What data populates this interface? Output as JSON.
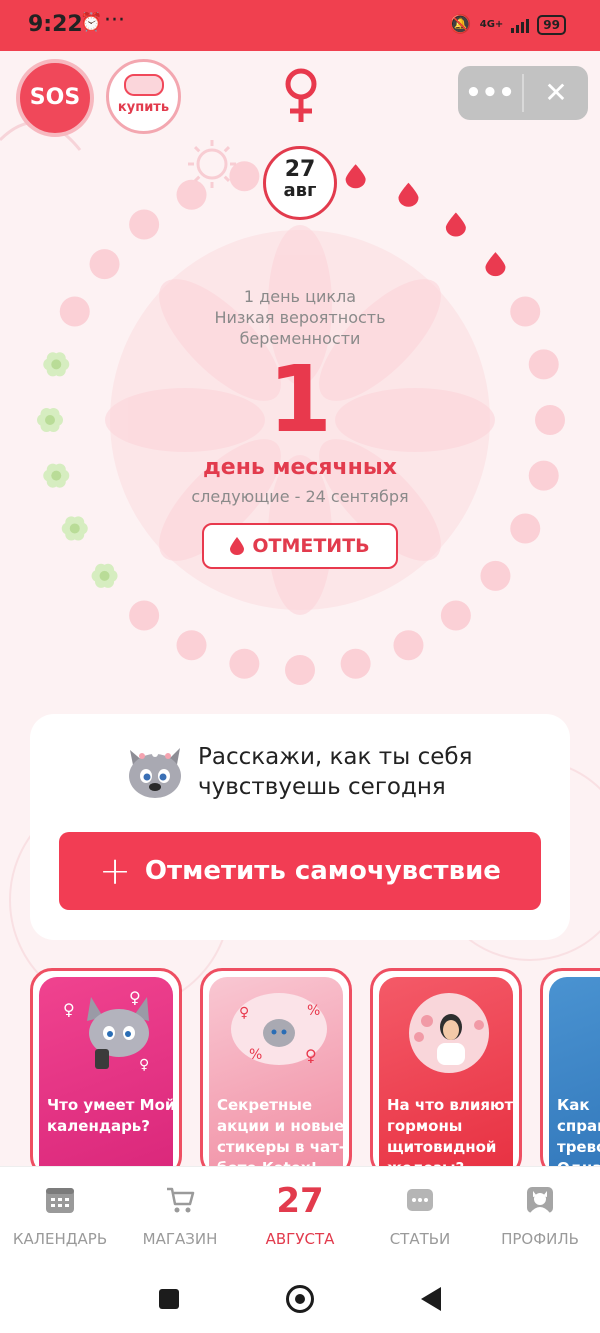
{
  "status_bar": {
    "time": "9:22",
    "dots": "···",
    "network": "4G+",
    "battery": "99"
  },
  "header": {
    "sos_label": "SOS",
    "buy_label": "купить",
    "more_label": "•••",
    "close_label": "✕"
  },
  "cycle": {
    "date_day": "27",
    "date_month": "авг",
    "cycle_day_line1": "1 день цикла",
    "cycle_day_line2": "Низкая вероятность",
    "cycle_day_line3": "беременности",
    "big_number": "1",
    "period_title": "день месячных",
    "next_period": "следующие - 24 сентября",
    "mark_button": "ОТМЕТИТЬ"
  },
  "mood": {
    "prompt_line1": "Расскажи, как ты себя",
    "prompt_line2": "чувствуешь сегодня",
    "button_plus": "+",
    "button_label": "Отметить самочувствие"
  },
  "articles": [
    {
      "title": "Что умеет Мой календарь?",
      "color": "#e8358a"
    },
    {
      "title": "Секретные акции и новые стикеры в чат-боте Kotex!",
      "color": "#f6a8b8"
    },
    {
      "title": "На что влияют гормоны щитовидной железы?",
      "color": "#ef3d4f"
    },
    {
      "title": "Как справиться с тревогой? Одна",
      "color": "#3f88c9"
    }
  ],
  "bottom_nav": {
    "calendar": "КАЛЕНДАРЬ",
    "shop": "МАГАЗИН",
    "today_number": "27",
    "today_label": "АВГУСТА",
    "articles": "СТАТЬИ",
    "profile": "ПРОФИЛЬ"
  },
  "colors": {
    "accent": "#e8394d",
    "status_bar": "#f0404f",
    "background": "#fdf2f3"
  }
}
